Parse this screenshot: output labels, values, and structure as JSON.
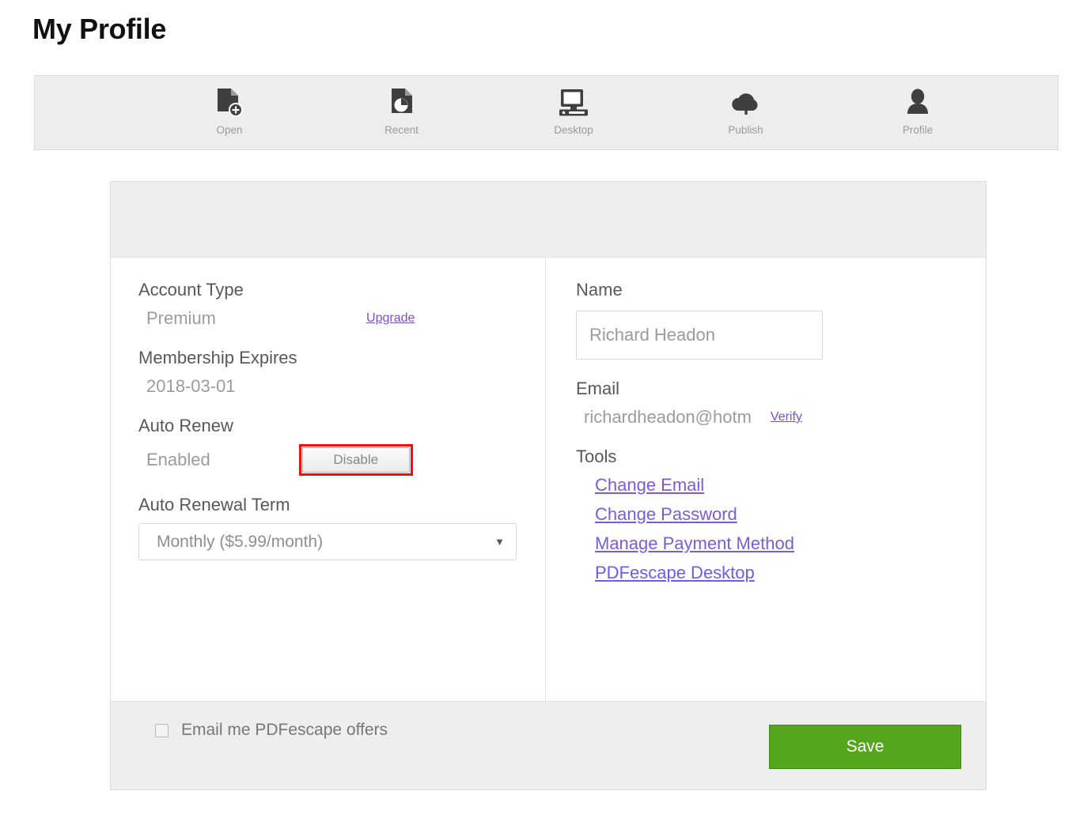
{
  "page": {
    "title": "My Profile"
  },
  "toolbar": {
    "items": [
      {
        "label": "Open",
        "icon": "document-add-icon"
      },
      {
        "label": "Recent",
        "icon": "document-clock-icon"
      },
      {
        "label": "Desktop",
        "icon": "monitor-icon"
      },
      {
        "label": "Publish",
        "icon": "cloud-upload-icon"
      },
      {
        "label": "Profile",
        "icon": "user-icon"
      }
    ]
  },
  "account": {
    "account_type_label": "Account Type",
    "account_type_value": "Premium",
    "upgrade_link": "Upgrade",
    "membership_expires_label": "Membership Expires",
    "membership_expires_value": "2018-03-01",
    "auto_renew_label": "Auto Renew",
    "auto_renew_value": "Enabled",
    "disable_button": "Disable",
    "auto_renewal_term_label": "Auto Renewal Term",
    "auto_renewal_term_value": "Monthly ($5.99/month)",
    "select_arrow": "▼"
  },
  "profile": {
    "name_label": "Name",
    "name_value": "Richard Headon",
    "email_label": "Email",
    "email_value": "richardheadon@hotm",
    "verify_link": "Verify",
    "tools_label": "Tools",
    "tools": [
      {
        "label": "Change Email"
      },
      {
        "label": "Change Password"
      },
      {
        "label": "Manage Payment Method"
      },
      {
        "label": "PDFescape Desktop"
      }
    ]
  },
  "footer": {
    "offers_label": "Email me PDFescape offers",
    "save_button": "Save"
  },
  "colors": {
    "link_purple": "#7b5cd6",
    "save_green": "#55a61c",
    "highlight_red": "#f60b0b",
    "toolbar_bg": "#ededed"
  }
}
